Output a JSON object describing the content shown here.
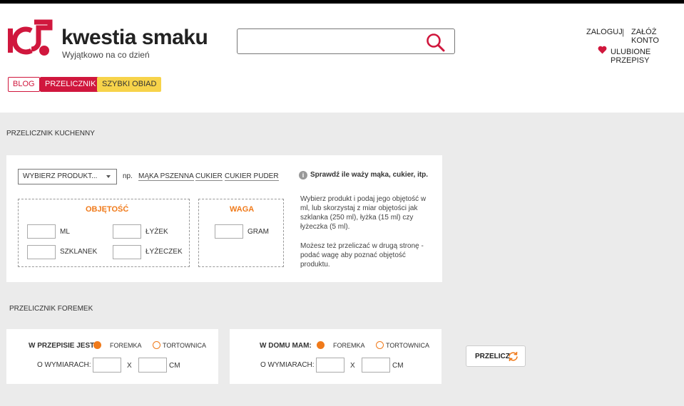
{
  "brand": {
    "name": "kwestia smaku",
    "tagline": "Wyjątkowo na co dzień",
    "accent": "#d0173d"
  },
  "search": {
    "value": "",
    "placeholder": "",
    "icon": "search-icon"
  },
  "account": {
    "login": "ZALOGUJ",
    "separator": "|",
    "register": "ZAŁÓŻ KONTO",
    "favorites": "ULUBIONE PRZEPISY",
    "favorites_icon": "heart-icon"
  },
  "tags": {
    "blog": "BLOG",
    "calculator": "PRZELICZNIK",
    "fast_dinner": "SZYBKI OBIAD"
  },
  "kitchen": {
    "title": "PRZELICZNIK KUCHENNY",
    "product_select": "WYBIERZ PRODUKT...",
    "examples_prefix": "np.",
    "examples": [
      "MĄKA PSZENNA",
      "CUKIER",
      "CUKIER PUDER"
    ],
    "volume_title": "OBJĘTOŚĆ",
    "volume_units": {
      "ml": "ML",
      "tbsp": "ŁYŻEK",
      "glass": "SZKLANEK",
      "tsp": "ŁYŻECZEK"
    },
    "weight_title": "WAGA",
    "weight_unit": "GRAM",
    "info_title": "Sprawdź ile waży mąka, cukier, itp.",
    "info_p1": "Wybierz produkt i podaj jego objętość w ml, lub skorzystaj z miar objętości jak szklanka (250 ml), łyżka (15 ml) czy łyżeczka (5 ml).",
    "info_p2": "Możesz też przeliczać w drugą stronę - podać wagę aby poznać objętość produktu."
  },
  "forms": {
    "title": "PRZELICZNIK FOREMEK",
    "left": {
      "label": "W PRZEPISIE JEST:",
      "opt1": "FOREMKA",
      "opt2": "TORTOWNICA",
      "selected": "FOREMKA",
      "dims_label": "O WYMIARACH:",
      "x": "X",
      "unit": "CM"
    },
    "right": {
      "label": "W DOMU MAM:",
      "opt1": "FOREMKA",
      "opt2": "TORTOWNICA",
      "selected": "FOREMKA",
      "dims_label": "O WYMIARACH:",
      "x": "X",
      "unit": "CM"
    },
    "button": "PRZELICZ"
  }
}
